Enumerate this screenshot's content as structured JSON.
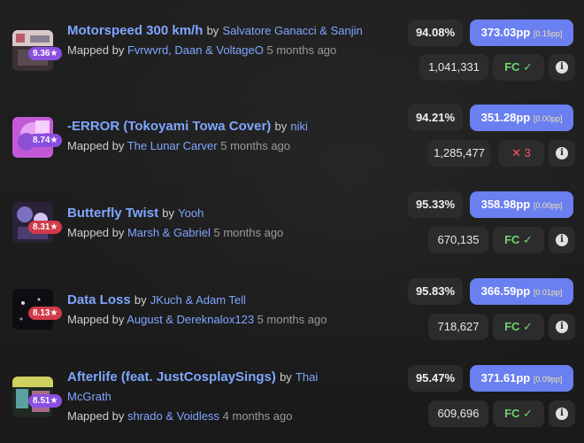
{
  "scores": [
    {
      "song": "Motorspeed 300 km/h",
      "by": "by",
      "artist": "Salvatore Ganacci & Sanjin",
      "mapped_prefix": "Mapped by",
      "mapper": "Fvrwvrd, Daan & VoltageO",
      "ago": "5 months ago",
      "stars": "9.36★",
      "star_color": "#8a4fe0",
      "accuracy": "94.08%",
      "pp": "373.03pp",
      "weight": "[0.15pp]",
      "score": "1,041,331",
      "status_type": "fc",
      "status_text": "FC",
      "status_icon": "check-icon"
    },
    {
      "song": "-ERROR (Tokoyami Towa Cover)",
      "by": "by",
      "artist": "niki",
      "mapped_prefix": "Mapped by",
      "mapper": "The Lunar Carver",
      "ago": "5 months ago",
      "stars": "8.74★",
      "star_color": "#8a4fe0",
      "accuracy": "94.21%",
      "pp": "351.28pp",
      "weight": "[0.00pp]",
      "score": "1,285,477",
      "status_type": "miss",
      "status_text": "3",
      "status_icon": "cross-icon"
    },
    {
      "song": "Butterfly Twist",
      "by": "by",
      "artist": "Yooh",
      "mapped_prefix": "Mapped by",
      "mapper": "Marsh & Gabriel",
      "ago": "5 months ago",
      "stars": "8.31★",
      "star_color": "#d13a4a",
      "accuracy": "95.33%",
      "pp": "358.98pp",
      "weight": "[0.00pp]",
      "score": "670,135",
      "status_type": "fc",
      "status_text": "FC",
      "status_icon": "check-icon"
    },
    {
      "song": "Data Loss",
      "by": "by",
      "artist": "JKuch & Adam Tell",
      "mapped_prefix": "Mapped by",
      "mapper": "August & Dereknalox123",
      "ago": "5 months ago",
      "stars": "8.13★",
      "star_color": "#d13a4a",
      "accuracy": "95.83%",
      "pp": "366.59pp",
      "weight": "[0.01pp]",
      "score": "718,627",
      "status_type": "fc",
      "status_text": "FC",
      "status_icon": "check-icon"
    },
    {
      "song": "Afterlife (feat. JustCosplaySings)",
      "by": "by",
      "artist": "Thai McGrath",
      "mapped_prefix": "Mapped by",
      "mapper": "shrado & Voidless",
      "ago": "4 months ago",
      "stars": "8.51★",
      "star_color": "#8a4fe0",
      "accuracy": "95.47%",
      "pp": "371.61pp",
      "weight": "[0.09pp]",
      "score": "609,696",
      "status_type": "fc",
      "status_text": "FC",
      "status_icon": "check-icon"
    }
  ],
  "info_icon": "info-icon",
  "colors": {
    "link": "#7fa6ff",
    "pp_badge": "#6a7ff0",
    "fc": "#6fd36f",
    "miss": "#ff5a6a"
  }
}
